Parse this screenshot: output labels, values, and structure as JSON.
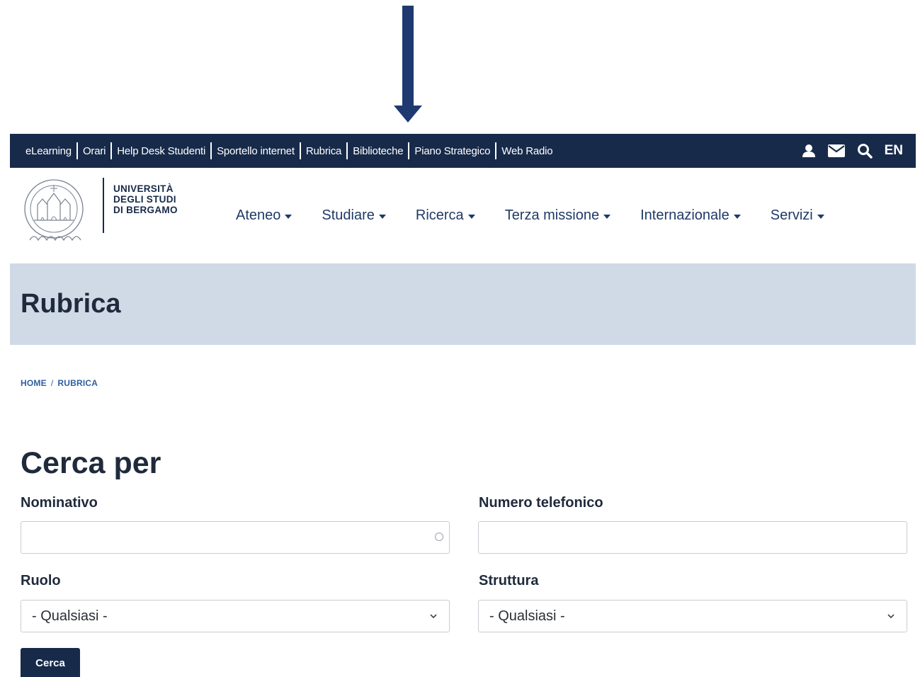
{
  "topbar": {
    "links": [
      "eLearning",
      "Orari",
      "Help Desk Studenti",
      "Sportello internet",
      "Rubrica",
      "Biblioteche",
      "Piano Strategico",
      "Web Radio"
    ],
    "tools": {
      "user_icon": "user-icon",
      "mail_icon": "mail-icon",
      "search_icon": "search-icon",
      "lang": "EN"
    }
  },
  "logo": {
    "line1": "UNIVERSITÀ",
    "line2": "DEGLI STUDI",
    "line3": "DI BERGAMO"
  },
  "menu": [
    "Ateneo",
    "Studiare",
    "Ricerca",
    "Terza missione",
    "Internazionale",
    "Servizi"
  ],
  "banner": {
    "title": "Rubrica"
  },
  "breadcrumb": [
    "HOME",
    "RUBRICA"
  ],
  "form": {
    "title": "Cerca per",
    "nominativo_label": "Nominativo",
    "nominativo_value": "",
    "telefono_label": "Numero telefonico",
    "telefono_value": "",
    "ruolo_label": "Ruolo",
    "ruolo_selected": "- Qualsiasi -",
    "struttura_label": "Struttura",
    "struttura_selected": "- Qualsiasi -",
    "submit_label": "Cerca"
  },
  "colors": {
    "navy": "#172a4a",
    "banner": "#d0dae6",
    "menu_text": "#1f3a66",
    "arrow": "#1e3a70"
  }
}
